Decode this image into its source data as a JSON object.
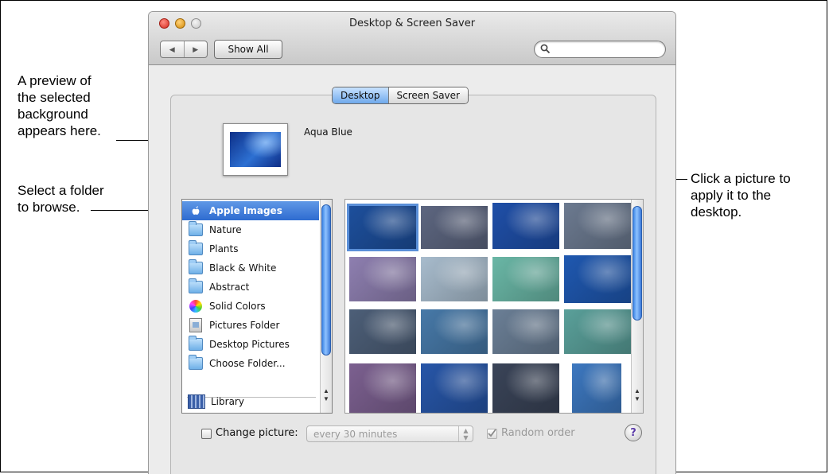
{
  "window": {
    "title": "Desktop & Screen Saver",
    "show_all_label": "Show All",
    "search_placeholder": ""
  },
  "tabs": [
    {
      "label": "Desktop",
      "active": true
    },
    {
      "label": "Screen Saver",
      "active": false
    }
  ],
  "preview": {
    "name": "Aqua Blue"
  },
  "sources": [
    {
      "label": "Apple Images",
      "icon": "apple-icon",
      "selected": true
    },
    {
      "label": "Nature",
      "icon": "folder-icon",
      "selected": false
    },
    {
      "label": "Plants",
      "icon": "folder-icon",
      "selected": false
    },
    {
      "label": "Black & White",
      "icon": "folder-icon",
      "selected": false
    },
    {
      "label": "Abstract",
      "icon": "folder-icon",
      "selected": false
    },
    {
      "label": "Solid Colors",
      "icon": "color-wheel-icon",
      "selected": false
    },
    {
      "label": "Pictures Folder",
      "icon": "pictures-folder-icon",
      "selected": false
    },
    {
      "label": "Desktop Pictures",
      "icon": "folder-icon",
      "selected": false
    },
    {
      "label": "Choose Folder...",
      "icon": "folder-icon",
      "selected": false
    },
    {
      "label": "Library",
      "icon": "library-icon",
      "selected": false
    }
  ],
  "thumbnail_colors": [
    [
      "#1d4f9c",
      "#5d6680",
      "#1f4fa8",
      "#6c7a90"
    ],
    [
      "#8e7fb0",
      "#a8bccd",
      "#6ab7a6",
      "#1f58b0"
    ],
    [
      "#4d5f78",
      "#4779a8",
      "#6b7f96",
      "#5aa09a"
    ],
    [
      "#7c6090",
      "#2756a8",
      "#3a4458",
      "#3d78c0"
    ]
  ],
  "bottom": {
    "change_picture_label": "Change picture:",
    "interval_value": "every 30 minutes",
    "random_order_label": "Random order",
    "help_label": "?"
  },
  "annotations": {
    "preview": "A preview of\nthe selected\nbackground\nappears here.",
    "folder": "Select a folder\nto browse.",
    "picture": "Click a picture to\napply it to the\ndesktop."
  },
  "colors": {
    "selection": "#2e6bd0",
    "scroll_thumb": "#3d86e6"
  }
}
